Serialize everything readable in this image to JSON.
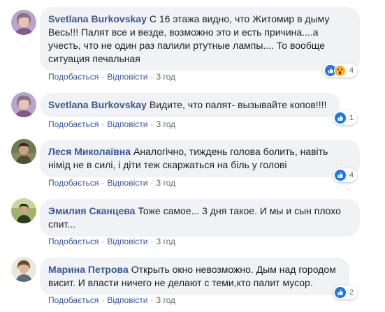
{
  "comments": [
    {
      "author": "Svetlana Burkovskay",
      "text": "С 16 этажа видно, что Житомир в дыму Весь!!! Палят все и везде, возможно это и есть причина....а учесть, что не один раз палили ртутные лампы.... То вообще ситуация печальная",
      "like_label": "Подобається",
      "reply_label": "Відповісти",
      "time": "3 год",
      "reactions": {
        "count": "4",
        "icons": [
          "like-icon",
          "wow-icon"
        ]
      }
    },
    {
      "author": "Svetlana Burkovskay",
      "text": "Видите, что палят- вызывайте копов!!!!",
      "like_label": "Подобається",
      "reply_label": "Відповісти",
      "time": "3 год",
      "reactions": {
        "count": "1",
        "icons": [
          "like-icon"
        ]
      }
    },
    {
      "author": "Леся Миколаївна",
      "text": "Аналогічно, тиждень голова болить, навіть німід не в силі, і діти теж скаржаться на біль у голові",
      "like_label": "Подобається",
      "reply_label": "Відповісти",
      "time": "3 год",
      "reactions": {
        "count": "4",
        "icons": [
          "like-icon"
        ]
      }
    },
    {
      "author": "Эмилия Сканцева",
      "text": "Тоже самое... 3 дня такое. И мы и сын плохо спит...",
      "like_label": "Подобається",
      "reply_label": "Відповісти",
      "time": "3 год",
      "reactions": null
    },
    {
      "author": "Марина Петрова",
      "text": "Открыть окно невозможно. Дым над городом висит. И власти ничего не делают с теми,кто палит мусор.",
      "like_label": "Подобається",
      "reply_label": "Відповісти",
      "time": "3 год",
      "reactions": {
        "count": "2",
        "icons": [
          "like-icon"
        ]
      }
    }
  ],
  "colors": {
    "bubble_bg": "#f0f2f5",
    "link": "#385898",
    "meta": "#65676b",
    "like_blue": "#1877f2",
    "wow_yellow": "#f7b125"
  }
}
